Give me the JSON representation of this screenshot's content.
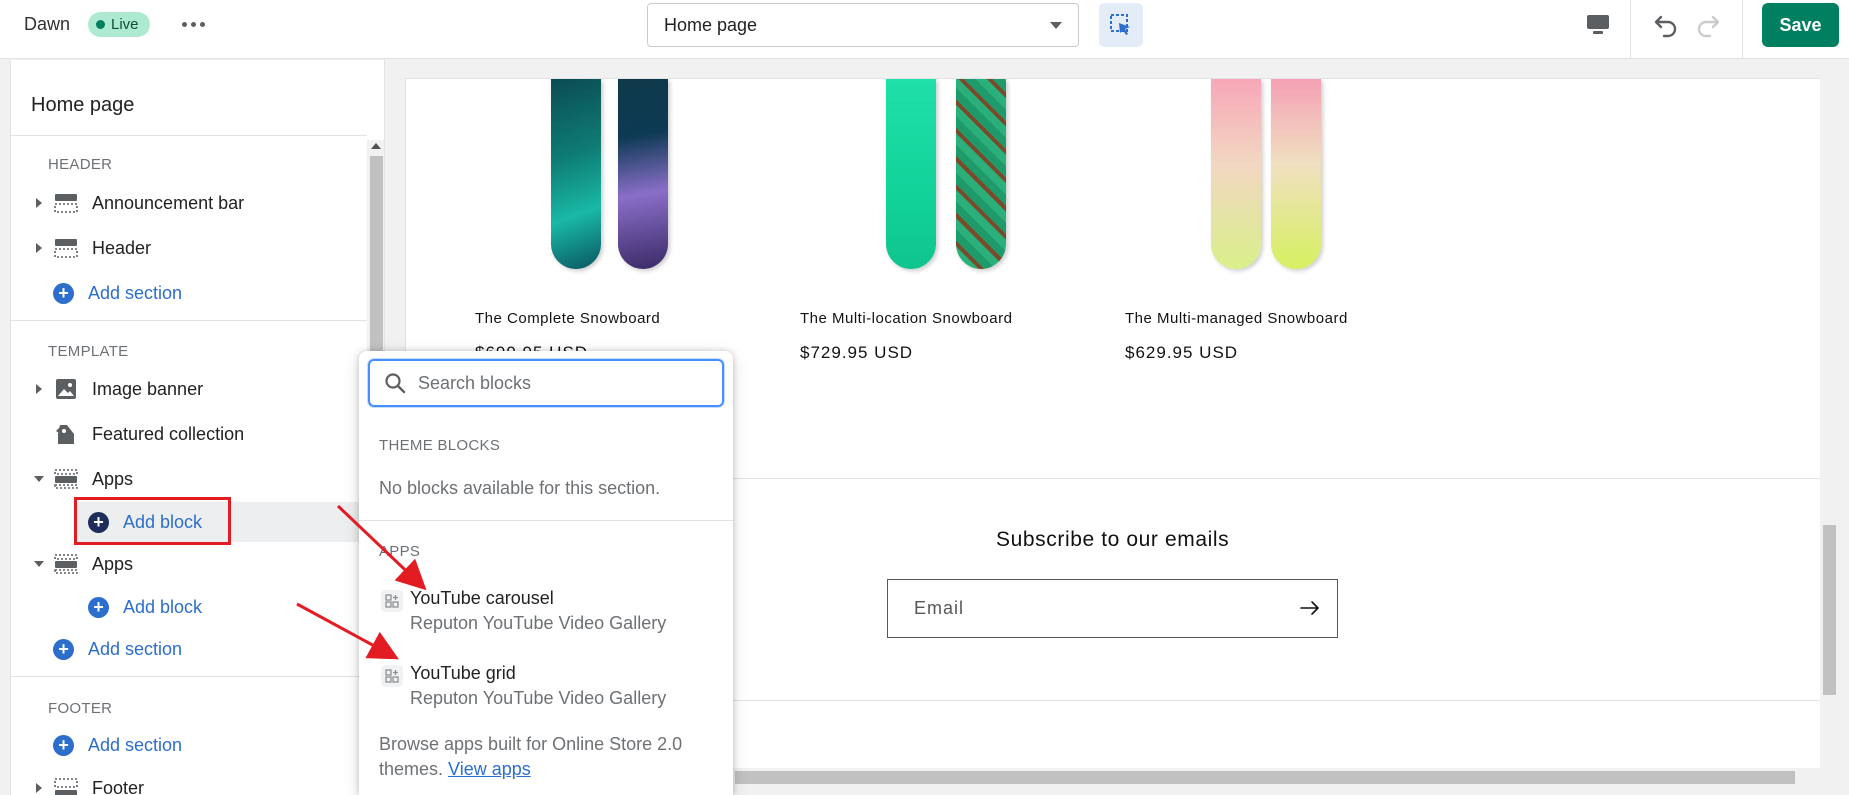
{
  "topbar": {
    "theme_name": "Dawn",
    "live_label": "Live",
    "page_select": "Home page",
    "save_label": "Save"
  },
  "sidebar": {
    "title": "Home page",
    "groups": {
      "header": "HEADER",
      "template": "TEMPLATE",
      "footer": "FOOTER"
    },
    "items": {
      "announcement_bar": "Announcement bar",
      "header": "Header",
      "add_section_1": "Add section",
      "image_banner": "Image banner",
      "featured_collection": "Featured collection",
      "apps_1": "Apps",
      "add_block_1": "Add block",
      "apps_2": "Apps",
      "add_block_2": "Add block",
      "add_section_2": "Add section",
      "add_section_3": "Add section",
      "footer": "Footer"
    }
  },
  "preview": {
    "products": [
      {
        "title": "The Complete Snowboard",
        "price": "$699.95 USD"
      },
      {
        "title": "The Multi-location Snowboard",
        "price": "$729.95 USD"
      },
      {
        "title": "The Multi-managed Snowboard",
        "price": "$629.95 USD"
      }
    ],
    "subscribe_heading": "Subscribe to our emails",
    "email_placeholder": "Email"
  },
  "popover": {
    "search_placeholder": "Search blocks",
    "theme_blocks_label": "THEME BLOCKS",
    "no_blocks_text": "No blocks available for this section.",
    "apps_label": "APPS",
    "apps": [
      {
        "name": "YouTube carousel",
        "provider": "Reputon YouTube Video Gallery"
      },
      {
        "name": "YouTube grid",
        "provider": "Reputon YouTube Video Gallery"
      }
    ],
    "browse_text": "Browse apps built for Online Store 2.0 themes.",
    "view_apps_link": "View apps"
  },
  "colors": {
    "accent": "#2c6ecb",
    "save": "#008060",
    "live_badge": "#aee9d1",
    "annotation": "#e31b23"
  },
  "icons": [
    "more-icon",
    "inspector-icon",
    "desktop-icon",
    "undo-icon",
    "redo-icon",
    "section-icon",
    "image-icon",
    "tag-icon",
    "plus-icon",
    "search-icon",
    "app-block-icon",
    "arrow-right-icon"
  ]
}
